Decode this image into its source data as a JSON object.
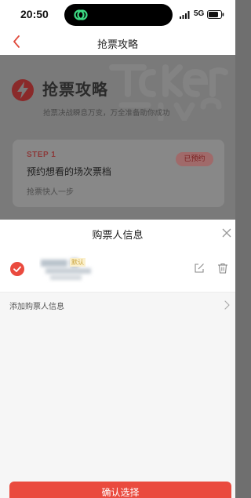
{
  "status_bar": {
    "time": "20:50",
    "network": "5G",
    "icons": [
      "signal-icon",
      "battery-icon",
      "island-app-icon"
    ]
  },
  "nav": {
    "title": "抢票攻略",
    "back_icon": "chevron-left-icon"
  },
  "guide": {
    "title": "抢票攻略",
    "subtitle": "抢票决战瞬息万变，万全准备助你成功",
    "step": {
      "label": "STEP 1",
      "title": "预约想看的场次票档",
      "description": "抢票快人一步",
      "badge": "已预约"
    }
  },
  "sheet": {
    "title": "购票人信息",
    "buyer": {
      "default_tag": "默认",
      "selected": true
    },
    "add_label": "添加购票人信息",
    "confirm_label": "确认选择"
  },
  "colors": {
    "accent": "#ea4a3e",
    "overlay": "#7a7a7a",
    "sheet_bg": "#f6f6f6"
  }
}
